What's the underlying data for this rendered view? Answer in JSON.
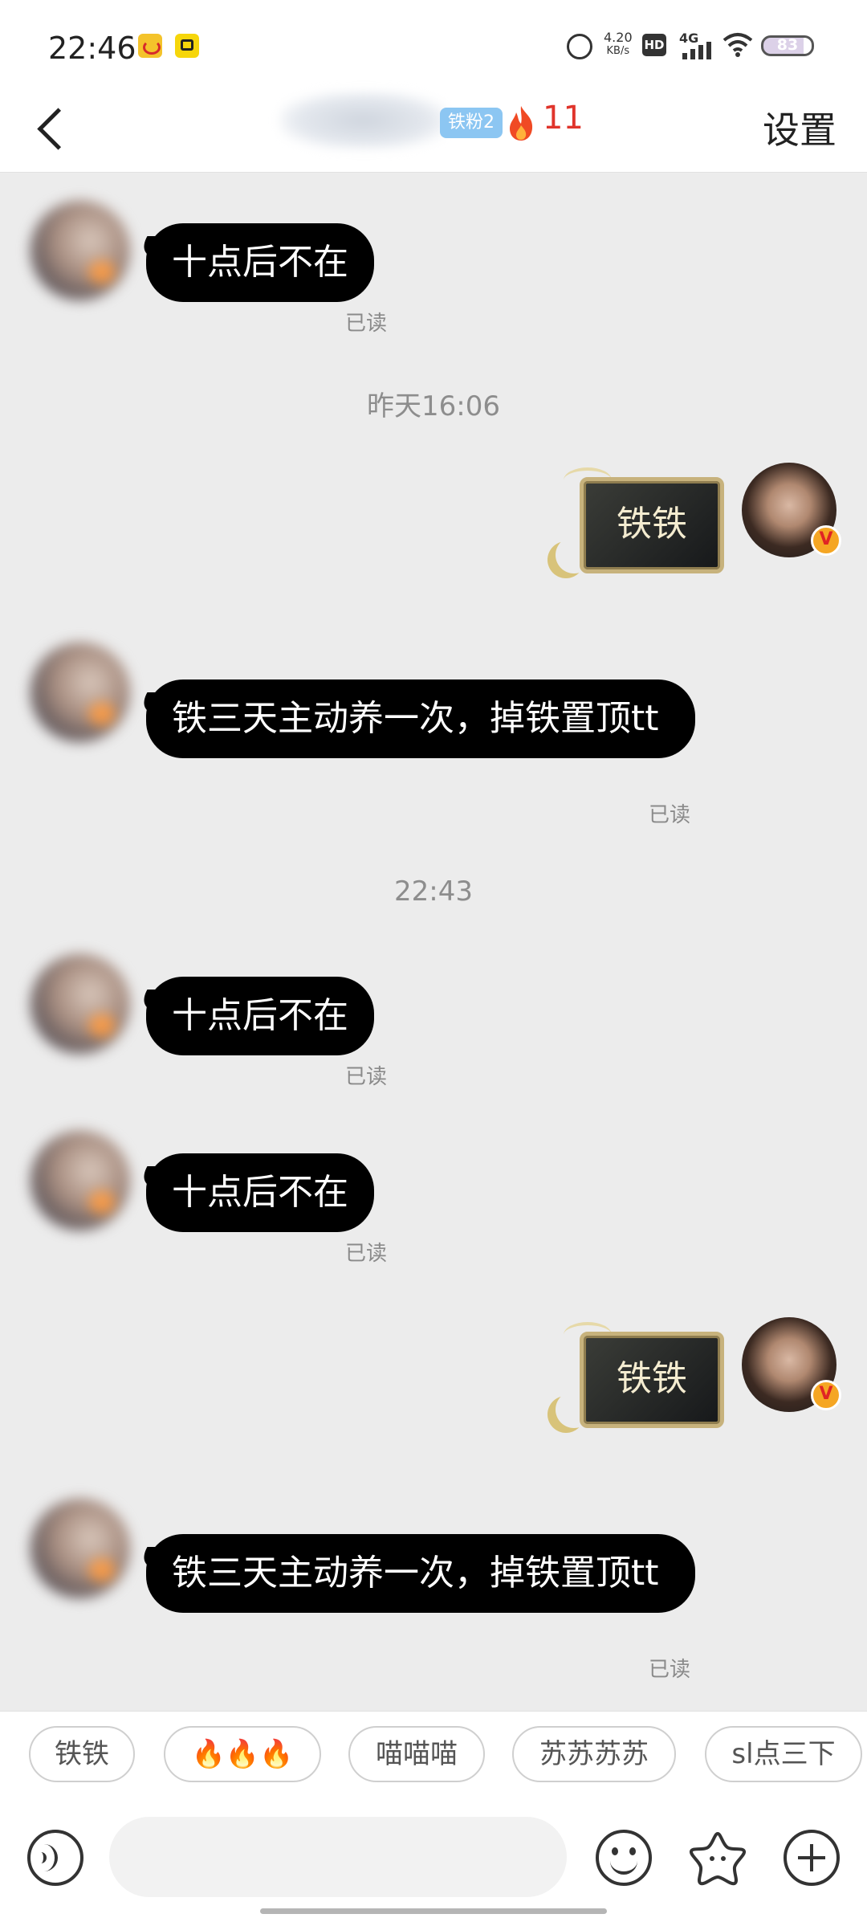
{
  "status_bar": {
    "time": "22:46",
    "net_speed_value": "4.20",
    "net_speed_unit": "KB/s",
    "hd_label": "HD",
    "network_label": "4G",
    "battery_level": "83"
  },
  "header": {
    "fan_badge": "铁粉2",
    "fire_count": "11",
    "settings_label": "设置"
  },
  "messages": [
    {
      "text": "十点后不在",
      "status": "已读"
    },
    {
      "timestamp": "昨天16:06"
    },
    {
      "sticker_text": "铁铁"
    },
    {
      "text": "铁三天主动养一次，掉铁置顶tt",
      "status": "已读"
    },
    {
      "timestamp": "22:43"
    },
    {
      "text": "十点后不在",
      "status": "已读"
    },
    {
      "text": "十点后不在",
      "status": "已读"
    },
    {
      "sticker_text": "铁铁"
    },
    {
      "text": "铁三天主动养一次，掉铁置顶tt",
      "status": "已读"
    }
  ],
  "quick_replies": [
    "铁铁",
    "🔥🔥🔥",
    "喵喵喵",
    "苏苏苏苏",
    "sl点三下"
  ],
  "input": {
    "placeholder": ""
  },
  "icons": {
    "back": "chevron-left-icon",
    "flame": "flame-icon",
    "voice": "voice-icon",
    "emoji": "emoji-icon",
    "sticker": "star-sticker-icon",
    "plus": "plus-icon"
  },
  "colors": {
    "bubble": "#000000",
    "fire_count": "#e0342b",
    "fan_badge": "#8cc6f2",
    "chat_background": "#ececec"
  }
}
